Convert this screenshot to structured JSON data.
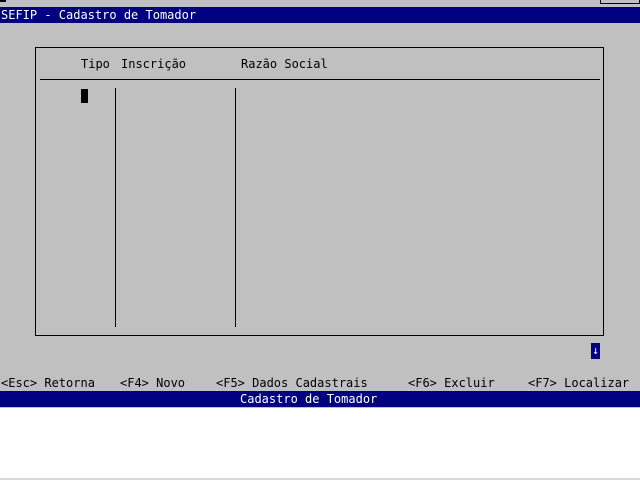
{
  "window": {
    "title": "SEFIP - Cadastro de Tomador"
  },
  "table": {
    "columns": [
      "Tipo",
      "Inscrição",
      "Razão Social"
    ],
    "rows": []
  },
  "scroll": {
    "indicator": "↓"
  },
  "function_keys": [
    "<Esc> Retorna",
    "<F4> Novo",
    "<F5> Dados Cadastrais",
    "<F6> Excluir",
    "<F7> Localizar"
  ],
  "status_bar": {
    "text": "Cadastro de Tomador"
  },
  "colors": {
    "title_bar": "#000080",
    "console_bg": "#c0c0c0",
    "text": "#000000",
    "inverse_text": "#ffffff"
  }
}
